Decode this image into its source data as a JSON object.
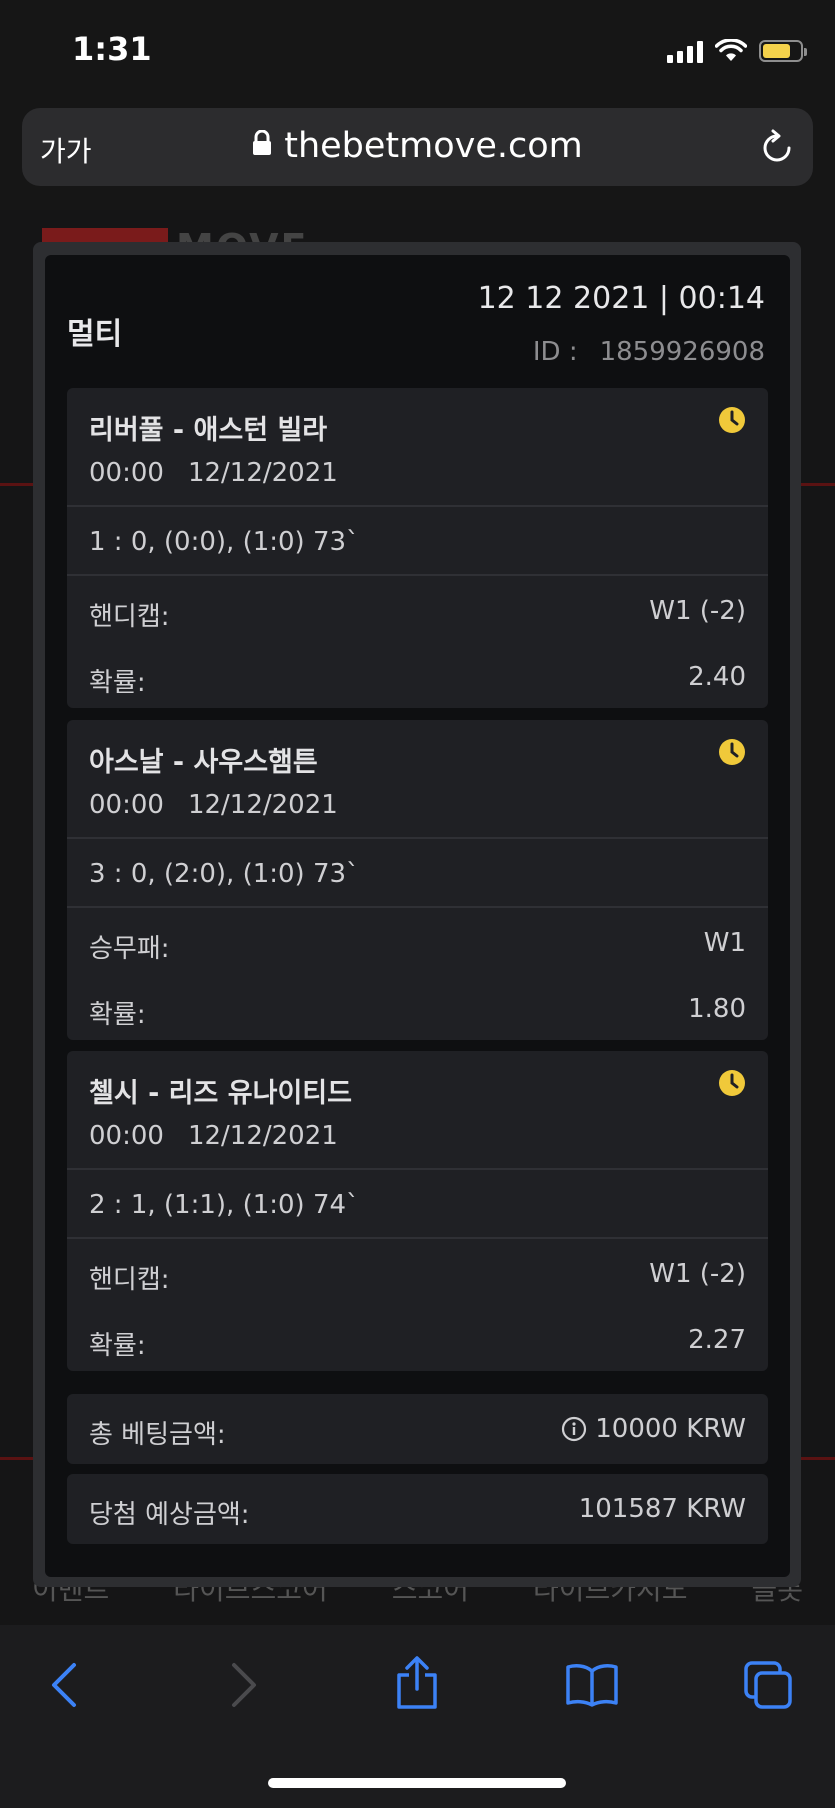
{
  "status_bar": {
    "time": "1:31",
    "battery_level": 0.75,
    "battery_color": "#f5d24b"
  },
  "browser": {
    "text_size_label": "가가",
    "url": "thebetmove.com",
    "icons": [
      "lock-icon",
      "reload-icon"
    ]
  },
  "background_page": {
    "logo_text": "MOVE",
    "nav_items": [
      "이벤트",
      "라이브스코어",
      "스코어",
      "라이브카지노",
      "슬롯"
    ]
  },
  "modal": {
    "bet_type": "멀티",
    "datetime": "12 12 2021 | 00:14",
    "id_label": "ID :",
    "id_value": "1859926908",
    "bets": [
      {
        "match": "리버풀 - 애스턴 빌라",
        "time": "00:00",
        "date": "12/12/2021",
        "score": "1 : 0, (0:0), (1:0) 73`",
        "market_label": "핸디캡:",
        "market_value": "W1 (-2)",
        "odds_label": "확률:",
        "odds_value": "2.40"
      },
      {
        "match": "아스날 - 사우스햄튼",
        "time": "00:00",
        "date": "12/12/2021",
        "score": "3 : 0, (2:0), (1:0) 73`",
        "market_label": "승무패:",
        "market_value": "W1",
        "odds_label": "확률:",
        "odds_value": "1.80"
      },
      {
        "match": "첼시 - 리즈 유나이티드",
        "time": "00:00",
        "date": "12/12/2021",
        "score": "2 : 1, (1:1), (1:0) 74`",
        "market_label": "핸디캡:",
        "market_value": "W1 (-2)",
        "odds_label": "확률:",
        "odds_value": "2.27"
      }
    ],
    "stake_label": "총 베팅금액:",
    "stake_value": "10000 KRW",
    "payout_label": "당첨 예상금액:",
    "payout_value": "101587 KRW"
  },
  "colors": {
    "accent_clock": "#f0c93a",
    "toolbar_blue": "#3c82f6"
  }
}
